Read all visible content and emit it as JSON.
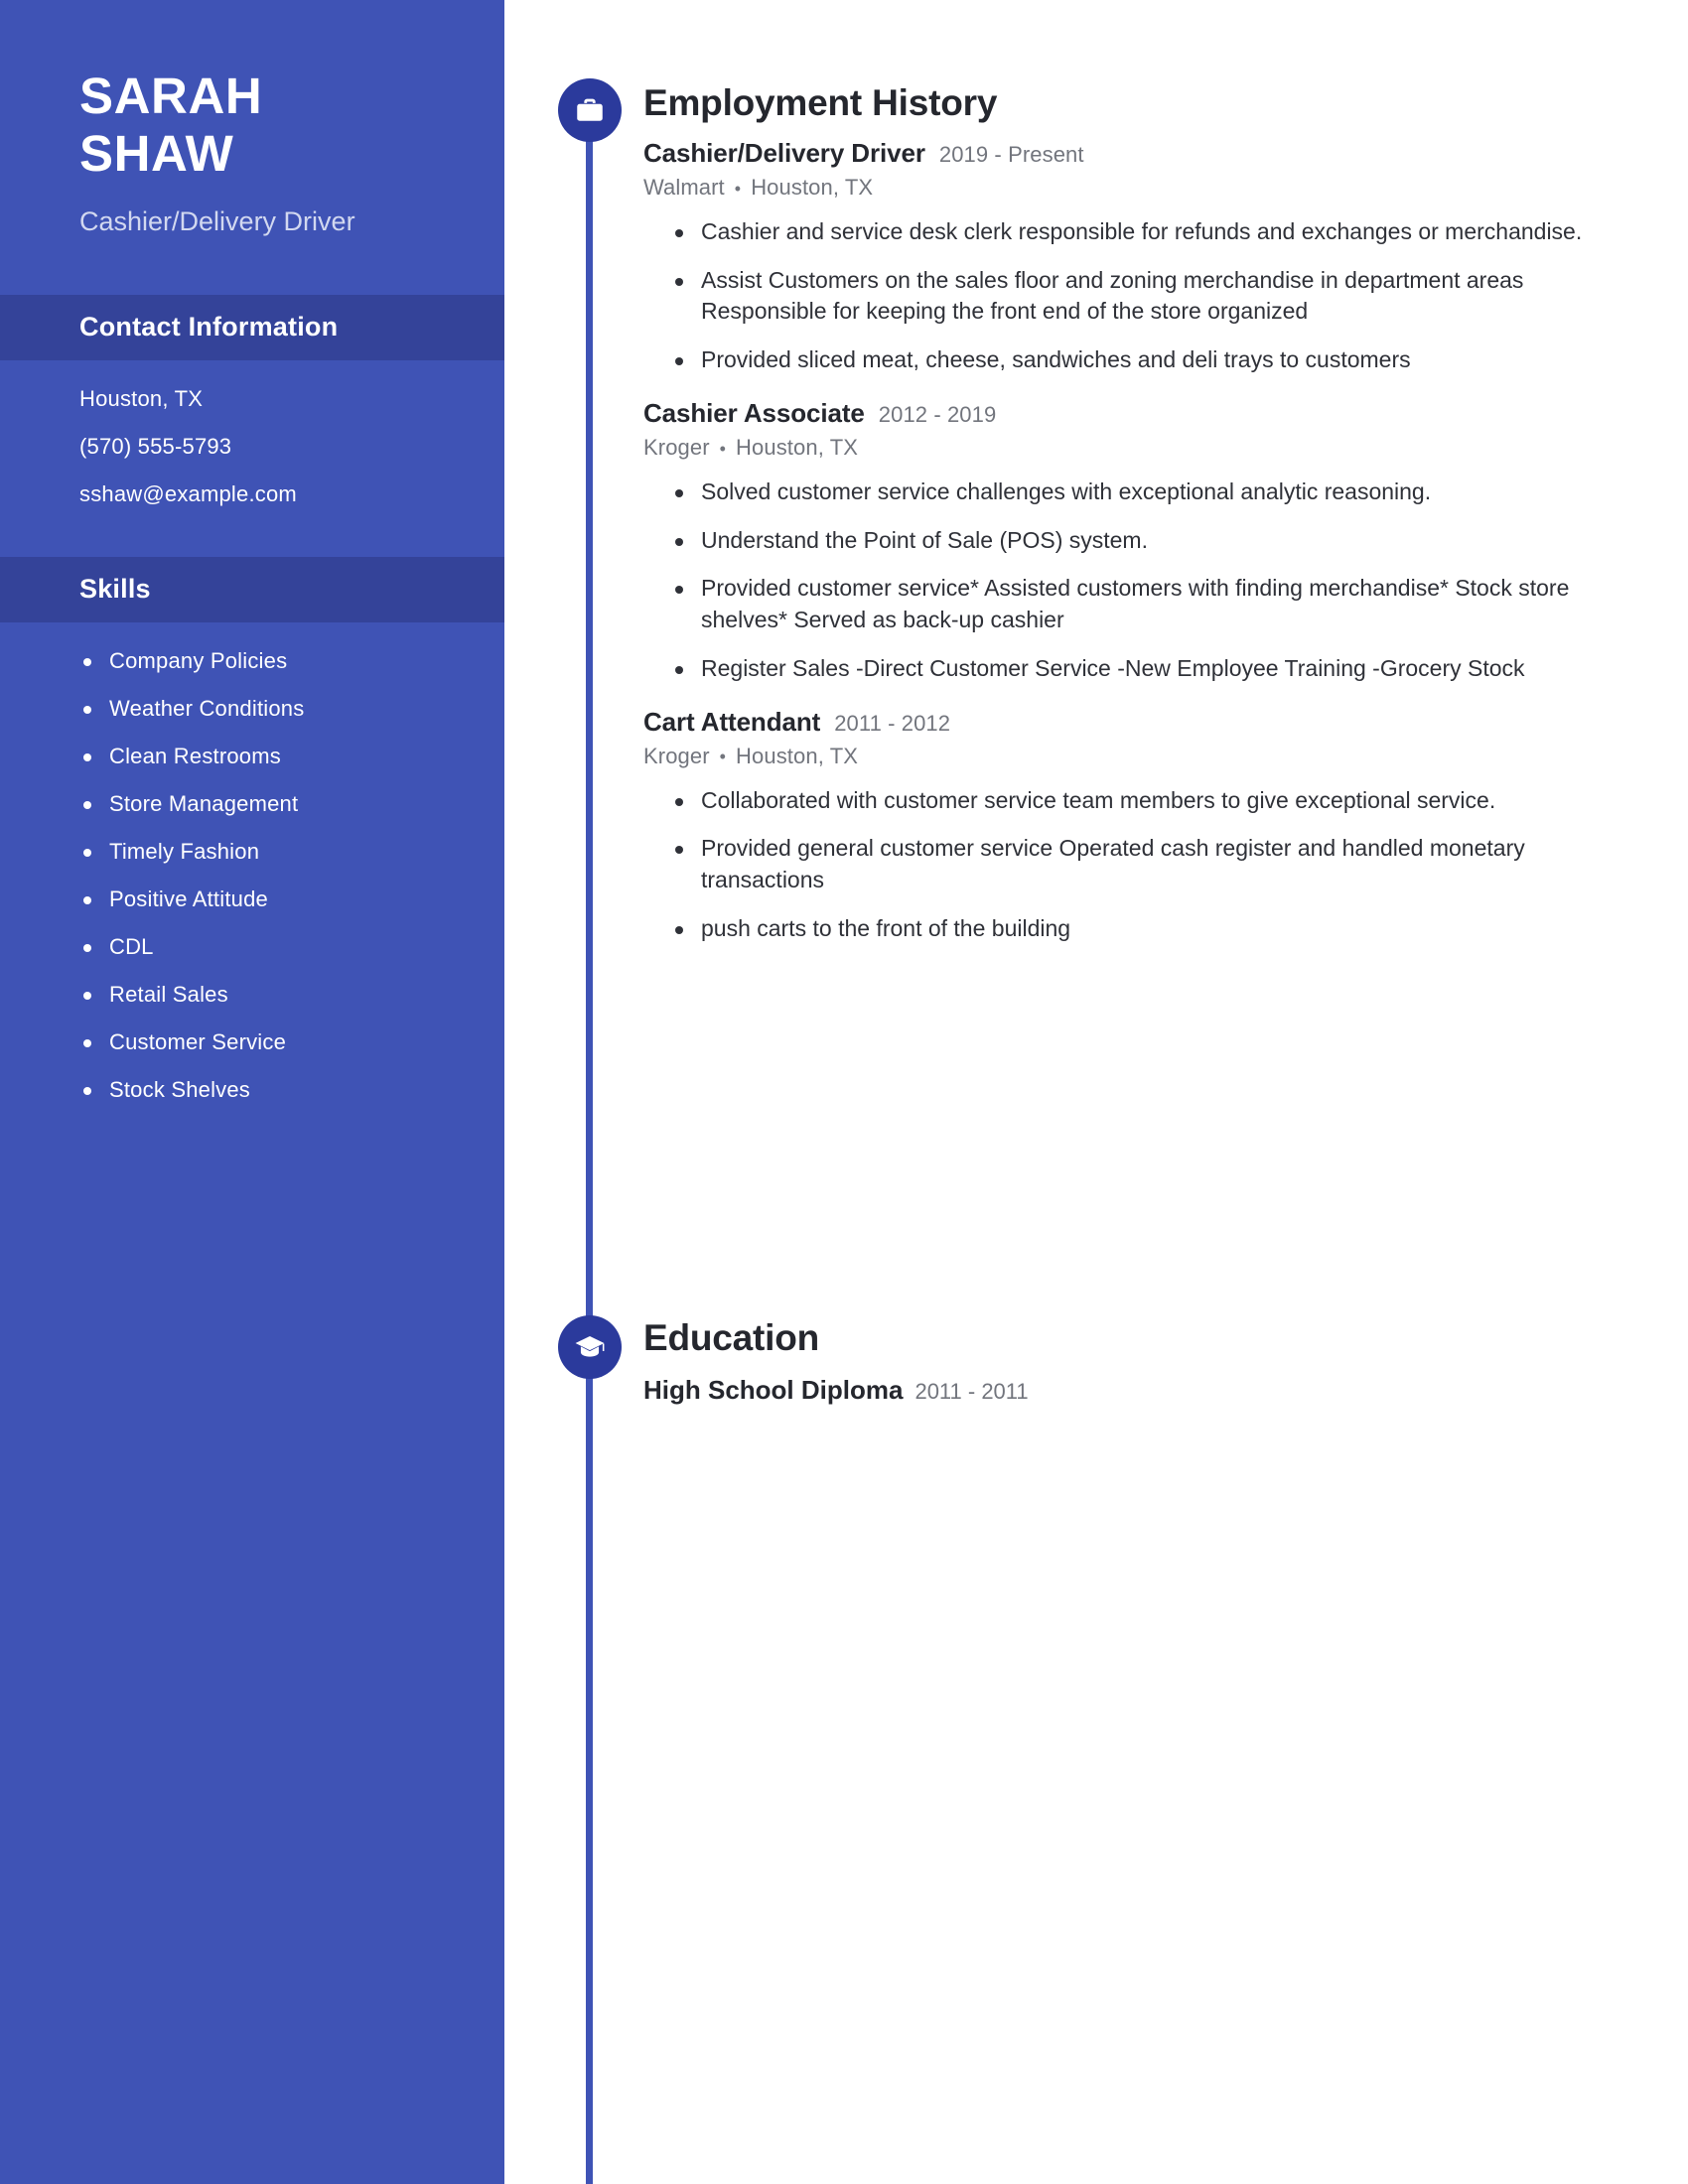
{
  "sidebar": {
    "name_line1": "SARAH",
    "name_line2": "SHAW",
    "role": "Cashier/Delivery Driver",
    "contact": {
      "heading": "Contact Information",
      "lines": [
        "Houston, TX",
        "(570) 555-5793",
        "sshaw@example.com"
      ]
    },
    "skills": {
      "heading": "Skills",
      "items": [
        "Company Policies",
        "Weather Conditions",
        "Clean Restrooms",
        "Store Management",
        "Timely Fashion",
        "Positive Attitude",
        "CDL",
        "Retail Sales",
        "Customer Service",
        "Stock Shelves"
      ]
    }
  },
  "main": {
    "employment": {
      "icon": "briefcase-icon",
      "title": "Employment History",
      "jobs": [
        {
          "title": "Cashier/Delivery Driver",
          "dates": "2019 - Present",
          "company": "Walmart",
          "location": "Houston, TX",
          "separator": "•",
          "bullets": [
            "Cashier and service desk clerk responsible for refunds and exchanges or merchandise.",
            "Assist Customers on the sales floor and zoning merchandise in department areas Responsible for keeping the front end of the store organized",
            "Provided sliced meat, cheese, sandwiches and deli trays to customers"
          ]
        },
        {
          "title": "Cashier Associate",
          "dates": "2012 - 2019",
          "company": "Kroger",
          "location": "Houston, TX",
          "separator": "•",
          "bullets": [
            "Solved customer service challenges with exceptional analytic reasoning.",
            "Understand the Point of Sale (POS) system.",
            "Provided customer service* Assisted customers with finding merchandise* Stock store shelves* Served as back-up cashier",
            "Register Sales -Direct Customer Service -New Employee Training -Grocery Stock"
          ]
        },
        {
          "title": "Cart Attendant",
          "dates": "2011 - 2012",
          "company": "Kroger",
          "location": "Houston, TX",
          "separator": "•",
          "bullets": [
            "Collaborated with customer service team members to give exceptional service.",
            "Provided general customer service Operated cash register and handled monetary transactions",
            "push carts to the front of the building"
          ]
        }
      ]
    },
    "education": {
      "icon": "graduation-cap-icon",
      "title": "Education",
      "entries": [
        {
          "degree": "High School Diploma",
          "dates": "2011 - 2011"
        }
      ]
    }
  },
  "colors": {
    "sidebar_bg": "#3f53b5",
    "sidebar_header_bg": "#344399",
    "badge_bg": "#2b3a9c",
    "timeline": "#3f53b5",
    "heading_text": "#25272e",
    "muted_text": "#72757d",
    "body_text": "#2f3138"
  }
}
